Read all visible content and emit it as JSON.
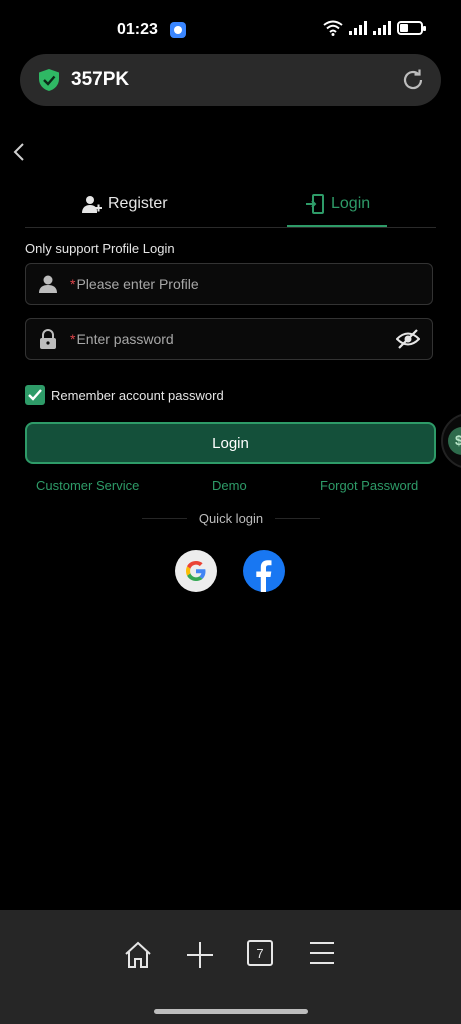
{
  "status_bar": {
    "time": "01:23",
    "icons": [
      "app-icon",
      "wifi-icon",
      "signal-icon",
      "signal-icon",
      "battery-icon"
    ]
  },
  "browser": {
    "url": "357PK",
    "security_icon": "shield-check-icon",
    "reload_icon": "reload-icon"
  },
  "auth": {
    "tabs": [
      {
        "label": "Register",
        "icon": "user-add-icon",
        "active": false
      },
      {
        "label": "Login",
        "icon": "login-door-icon",
        "active": true
      }
    ],
    "support_text": "Only support Profile Login",
    "profile_input": {
      "required_mark": "*",
      "placeholder": "Please enter Profile",
      "value": ""
    },
    "password_input": {
      "required_mark": "*",
      "placeholder": "Enter password",
      "value": ""
    },
    "remember": {
      "label": "Remember account password",
      "checked": true
    },
    "login_button": "Login",
    "links": {
      "customer_service": "Customer Service",
      "demo": "Demo",
      "forgot_password": "Forgot Password"
    },
    "quick_login_label": "Quick login",
    "social": [
      "google-icon",
      "facebook-icon"
    ]
  },
  "bottom_nav": {
    "tab_count": "7",
    "items": [
      "home-icon",
      "plus-icon",
      "tabs-icon",
      "menu-icon"
    ]
  },
  "colors": {
    "accent": "#2e9b68",
    "button_bg": "#14503a",
    "required": "#e0454b",
    "background": "#000000"
  }
}
